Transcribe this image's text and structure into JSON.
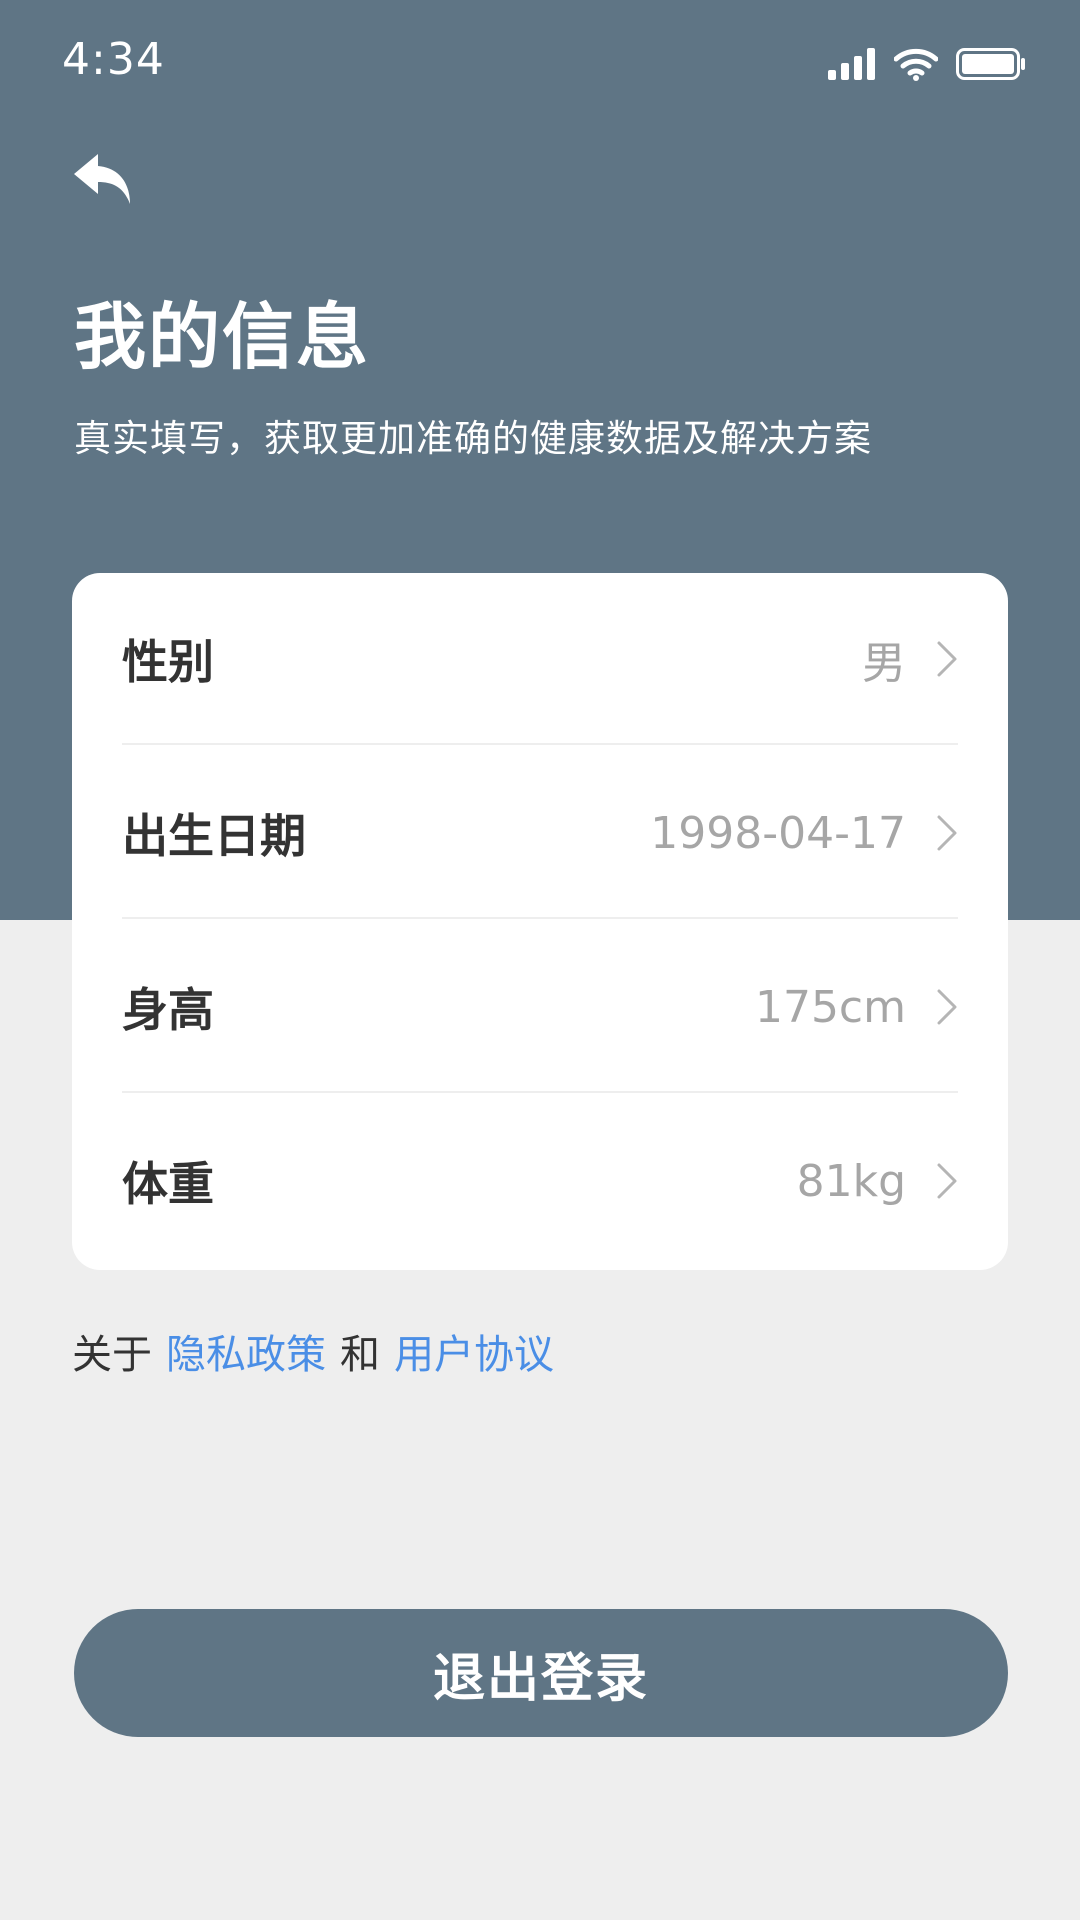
{
  "status_bar": {
    "time": "4:34",
    "icons": [
      "cellular-signal-icon",
      "wifi-icon",
      "battery-icon"
    ]
  },
  "header": {
    "back_icon": "back-arrow-icon",
    "title": "我的信息",
    "subtitle": "真实填写，获取更加准确的健康数据及解决方案"
  },
  "info_rows": [
    {
      "label": "性别",
      "value": "男"
    },
    {
      "label": "出生日期",
      "value": "1998-04-17"
    },
    {
      "label": "身高",
      "value": "175cm"
    },
    {
      "label": "体重",
      "value": "81kg"
    }
  ],
  "footer": {
    "prefix": "关于",
    "privacy_link": "隐私政策",
    "conjunction": "和",
    "agreement_link": "用户协议"
  },
  "logout_label": "退出登录",
  "colors": {
    "header_bg": "#5f7585",
    "page_bg": "#eeeeee",
    "link": "#4a8ee6",
    "value_gray": "#a6a6a6"
  }
}
